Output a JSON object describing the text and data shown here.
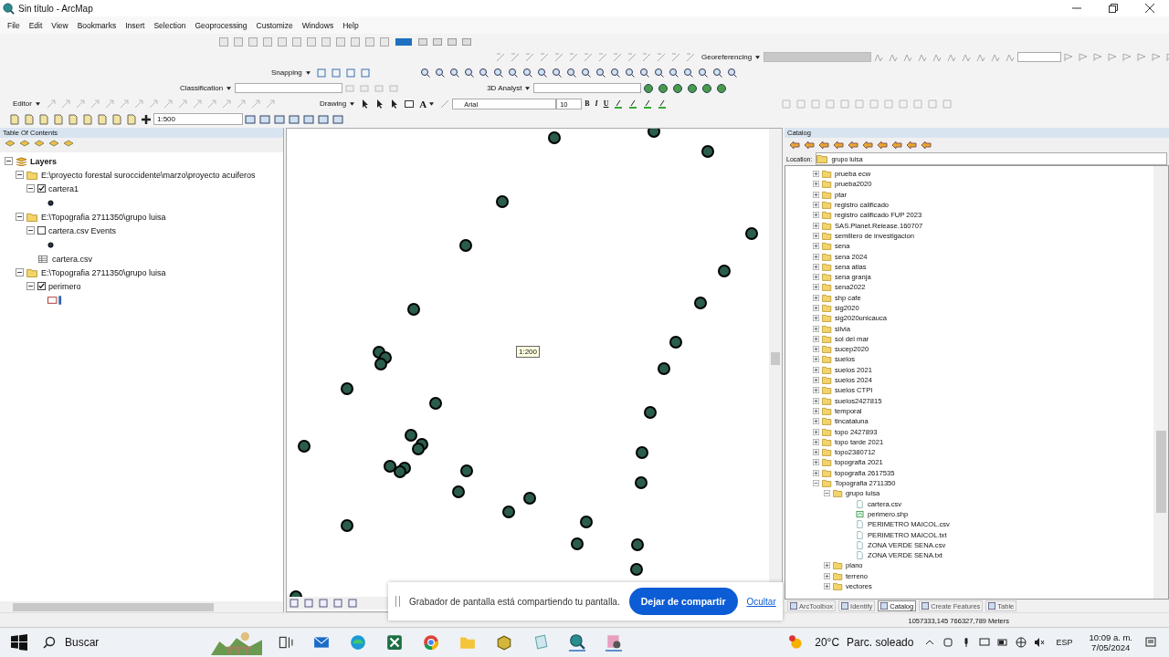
{
  "window": {
    "title": "Sin título - ArcMap"
  },
  "menu": [
    "File",
    "Edit",
    "View",
    "Bookmarks",
    "Insert",
    "Selection",
    "Geoprocessing",
    "Customize",
    "Windows",
    "Help"
  ],
  "toolbars": {
    "snapping": "Snapping",
    "georeferencing": "Georeferencing",
    "classification": "Classification",
    "analyst": "3D Analyst",
    "editor": "Editor",
    "drawing": "Drawing",
    "font": "Arial",
    "font_size": "10",
    "format": [
      "B",
      "I",
      "U"
    ],
    "font_color": "A",
    "scale": "1:500"
  },
  "toc": {
    "title": "Table Of Contents",
    "tree": [
      {
        "label": "Layers",
        "kind": "root",
        "expanded": true,
        "children": [
          {
            "label": "E:\\proyecto forestal suroccidente\\marzo\\proyecto acuiferos",
            "kind": "folder",
            "expanded": true,
            "children": [
              {
                "label": "cartera1",
                "kind": "layer",
                "checked": true,
                "expanded": true,
                "legend": {
                  "kind": "point"
                }
              }
            ]
          },
          {
            "label": "E:\\Topografia 2711350\\grupo luisa",
            "kind": "folder",
            "expanded": true,
            "children": [
              {
                "label": "cartera.csv Events",
                "kind": "layer",
                "checked": false,
                "expanded": true,
                "legend": {
                  "kind": "point"
                }
              },
              {
                "label": "cartera.csv",
                "kind": "table"
              }
            ]
          },
          {
            "label": "E:\\Topografia 2711350\\grupo luisa",
            "kind": "folder",
            "expanded": true,
            "children": [
              {
                "label": "perimero",
                "kind": "layer",
                "checked": true,
                "expanded": true,
                "legend": {
                  "kind": "polygon"
                }
              }
            ]
          }
        ]
      }
    ]
  },
  "map": {
    "scale_tip": "1:200"
  },
  "catalog": {
    "title": "Catalog",
    "location_label": "Location:",
    "location": "grupo luisa",
    "tree": [
      {
        "label": "prueba ecw",
        "kind": "folder",
        "expanded": false
      },
      {
        "label": "prueba2020",
        "kind": "folder",
        "expanded": false
      },
      {
        "label": "ptar",
        "kind": "folder",
        "expanded": false
      },
      {
        "label": "registro calificado",
        "kind": "folder",
        "expanded": false
      },
      {
        "label": "registro calificado FUP 2023",
        "kind": "folder",
        "expanded": false
      },
      {
        "label": "SAS.Planet.Release.160707",
        "kind": "folder",
        "expanded": false
      },
      {
        "label": "semillero de investigacion",
        "kind": "folder",
        "expanded": false
      },
      {
        "label": "sena",
        "kind": "folder",
        "expanded": false
      },
      {
        "label": "sena 2024",
        "kind": "folder",
        "expanded": false
      },
      {
        "label": "sena atlas",
        "kind": "folder",
        "expanded": false
      },
      {
        "label": "sena granja",
        "kind": "folder",
        "expanded": false
      },
      {
        "label": "sena2022",
        "kind": "folder",
        "expanded": false
      },
      {
        "label": "shp cafe",
        "kind": "folder",
        "expanded": false
      },
      {
        "label": "sig2020",
        "kind": "folder",
        "expanded": false
      },
      {
        "label": "sig2020unicauca",
        "kind": "folder",
        "expanded": false
      },
      {
        "label": "silvia",
        "kind": "folder",
        "expanded": false
      },
      {
        "label": "sol del mar",
        "kind": "folder",
        "expanded": false
      },
      {
        "label": "sucep2020",
        "kind": "folder",
        "expanded": false
      },
      {
        "label": "suelos",
        "kind": "folder",
        "expanded": false
      },
      {
        "label": "suelos 2021",
        "kind": "folder",
        "expanded": false
      },
      {
        "label": "suelos 2024",
        "kind": "folder",
        "expanded": false
      },
      {
        "label": "suelos CTPI",
        "kind": "folder",
        "expanded": false
      },
      {
        "label": "suelos2427815",
        "kind": "folder",
        "expanded": false
      },
      {
        "label": "temporal",
        "kind": "folder",
        "expanded": false
      },
      {
        "label": "tincataluna",
        "kind": "folder",
        "expanded": false
      },
      {
        "label": "topo 2427893",
        "kind": "folder",
        "expanded": false
      },
      {
        "label": "topo tarde 2021",
        "kind": "folder",
        "expanded": false
      },
      {
        "label": "topo2380712",
        "kind": "folder",
        "expanded": false
      },
      {
        "label": "topografia 2021",
        "kind": "folder",
        "expanded": false
      },
      {
        "label": "topografia 2617535",
        "kind": "folder",
        "expanded": false
      },
      {
        "label": "Topografia 2711350",
        "kind": "folder",
        "expanded": true,
        "children": [
          {
            "label": "grupo luisa",
            "kind": "folder",
            "expanded": true,
            "children": [
              {
                "label": "cartera.csv",
                "kind": "file"
              },
              {
                "label": "perimero.shp",
                "kind": "shapefile"
              },
              {
                "label": "PERIMETRO MAICOL.csv",
                "kind": "file"
              },
              {
                "label": "PERIMETRO MAICOL.txt",
                "kind": "file"
              },
              {
                "label": "ZONA VERDE SENA.csv",
                "kind": "file"
              },
              {
                "label": "ZONA VERDE SENA.txt",
                "kind": "file"
              }
            ]
          },
          {
            "label": "plano",
            "kind": "folder",
            "expanded": false
          },
          {
            "label": "terreno",
            "kind": "folder",
            "expanded": false
          },
          {
            "label": "vectores",
            "kind": "folder",
            "expanded": false
          }
        ]
      }
    ],
    "tabs": [
      {
        "label": "ArcToolbox",
        "selected": false
      },
      {
        "label": "Identify",
        "selected": false
      },
      {
        "label": "Catalog",
        "selected": true
      },
      {
        "label": "Create Features",
        "selected": false
      },
      {
        "label": "Table",
        "selected": false
      }
    ]
  },
  "status_bar": {
    "coordinates": "1057333,145  766327,789 Meters"
  },
  "share_banner": {
    "message": "Grabador de pantalla está compartiendo tu pantalla.",
    "stop_button": "Dejar de compartir",
    "hide_link": "Ocultar"
  },
  "taskbar": {
    "search": "Buscar",
    "temperature": "20°C",
    "weather": "Parc. soleado",
    "language": "ESP",
    "time": "10:09 a. m.",
    "date": "7/05/2024"
  }
}
